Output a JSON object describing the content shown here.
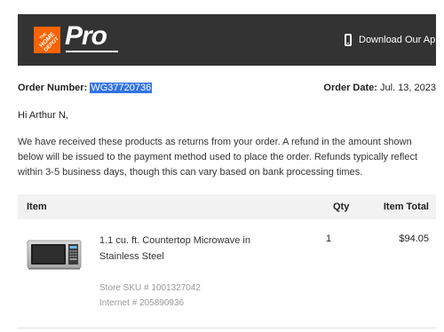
{
  "header": {
    "brand": "Pro",
    "logo_text": "THE HOME DEPOT",
    "app_link_label": "Download Our App",
    "app_link_chevron": "›",
    "brand_color": "#f96302",
    "header_bg": "#333333"
  },
  "order": {
    "number_label": "Order Number:",
    "number_value": "WG37720736",
    "date_label": "Order Date:",
    "date_value": "Jul. 13, 2023"
  },
  "greeting": "Hi Arthur N,",
  "message": "We have received these products as returns from your order. A refund in the amount shown below will be issued to the payment method used to place the order. Refunds typically reflect within 3-5 business days, though this can vary based on bank processing times.",
  "table": {
    "headers": {
      "item": "Item",
      "qty": "Qty",
      "total": "Item Total"
    },
    "rows": [
      {
        "name": "1.1 cu. ft. Countertop Microwave in Stainless Steel",
        "store_sku": "Store SKU # 1001327042",
        "internet": "Internet # 205890936",
        "qty": "1",
        "total": "$94.05",
        "image_icon": "microwave-icon"
      }
    ]
  }
}
